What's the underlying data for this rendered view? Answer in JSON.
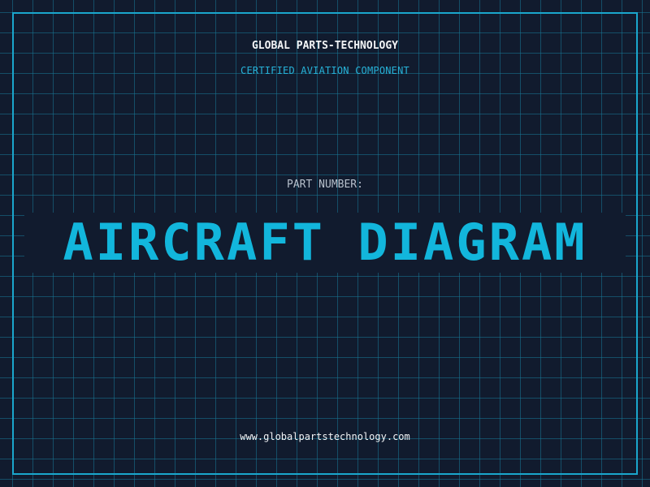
{
  "header": {
    "company": "GLOBAL PARTS-TECHNOLOGY",
    "subtitle": "CERTIFIED AVIATION COMPONENT"
  },
  "part": {
    "label": "PART NUMBER:",
    "value": "AIRCRAFT DIAGRAM"
  },
  "footer": {
    "website": "www.globalpartstechnology.com"
  },
  "colors": {
    "background": "#111b2e",
    "grid": "#18789a",
    "frame": "#1aa6cc",
    "accent": "#12b6dc",
    "text_light": "#f2f4f6",
    "text_muted": "#b7c0cc"
  }
}
